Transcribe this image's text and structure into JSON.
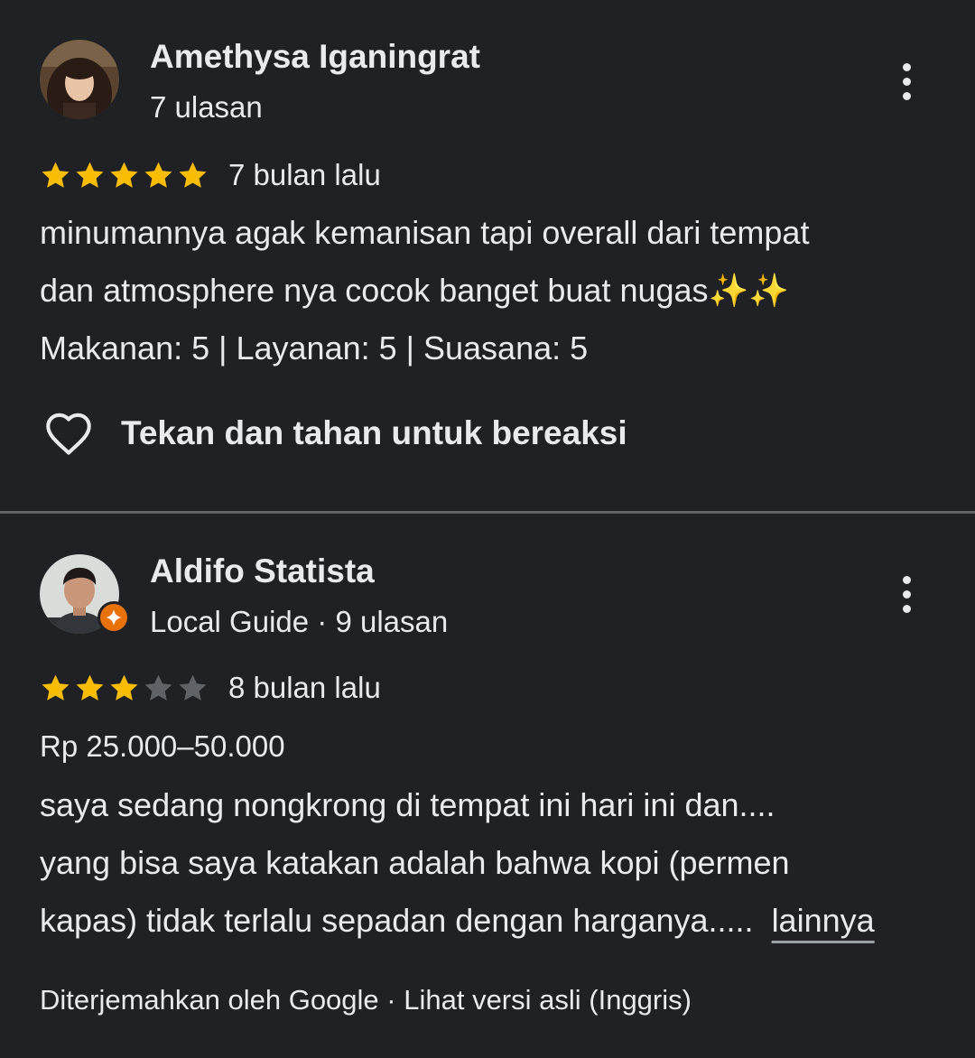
{
  "reviews": [
    {
      "author": "Amethysa Iganingrat",
      "meta": "7 ulasan",
      "rating": 5,
      "max_rating": 5,
      "date": "7 bulan lalu",
      "text_lines": [
        "minumannya agak kemanisan tapi overall dari tempat",
        "dan atmosphere nya cocok banget buat nugas✨✨",
        "Makanan: 5 | Layanan: 5 | Suasana: 5"
      ],
      "react_label": "Tekan dan tahan untuk bereaksi",
      "avatar_icon": "user-photo",
      "react_icon": "heart-outline-icon"
    },
    {
      "author": "Aldifo Statista",
      "meta": "Local Guide · 9 ulasan",
      "rating": 3,
      "max_rating": 5,
      "date": "8 bulan lalu",
      "price": "Rp 25.000–50.000",
      "text_lines": [
        "saya sedang nongkrong di tempat ini hari ini dan....",
        "yang bisa saya katakan adalah bahwa kopi (permen",
        "kapas) tidak terlalu sepadan dengan harganya....."
      ],
      "more_label": "lainnya",
      "translation_note": "Diterjemahkan oleh Google",
      "separator": " · ",
      "original_link": "Lihat versi asli (Inggris)",
      "badge_icon": "local-guide-badge-icon"
    }
  ],
  "colors": {
    "background": "#202124",
    "text": "#e8eaed",
    "star_filled": "#fbbc04",
    "star_empty": "#5f6368",
    "badge": "#e8710a",
    "divider": "#5f6368"
  }
}
